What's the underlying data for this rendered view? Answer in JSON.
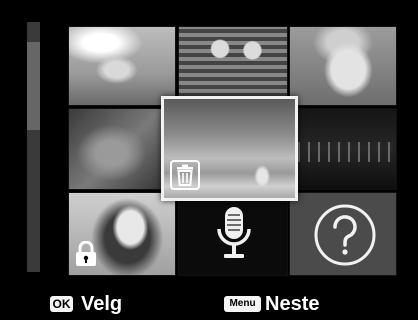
{
  "footer": {
    "select_key": "OK",
    "select_label": "Velg",
    "menu_key": "Menu",
    "menu_label": "Neste"
  },
  "thumbnails": [
    {
      "id": "photo-1",
      "icon": null
    },
    {
      "id": "photo-2",
      "icon": null
    },
    {
      "id": "photo-3",
      "icon": null
    },
    {
      "id": "photo-4",
      "icon": null
    },
    {
      "id": "photo-5-selected",
      "icon": "trash-icon"
    },
    {
      "id": "photo-6",
      "icon": null
    },
    {
      "id": "photo-7",
      "icon": "lock-icon"
    },
    {
      "id": "voice-memo",
      "icon": "microphone-icon"
    },
    {
      "id": "unknown-file",
      "icon": "question-mark-icon"
    }
  ],
  "colors": {
    "background": "#000000",
    "selection_border": "#f2f2f2",
    "key_background": "#f4f4f4",
    "text": "#ffffff"
  }
}
